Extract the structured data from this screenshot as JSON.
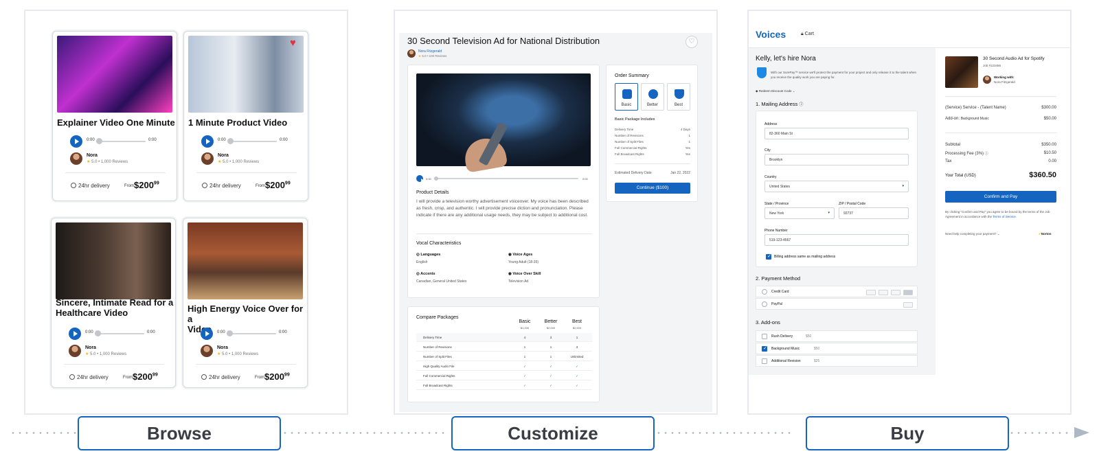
{
  "browse": {
    "cards": [
      {
        "title_lines": [
          "Explainer Video One Minute"
        ],
        "time_start": "0:00",
        "time_end": "0:00",
        "seller": "Nora",
        "rating": "5.0 • 1,000 Reviews",
        "delivery": "24hr delivery",
        "from": "From",
        "price": "$200",
        "price_cents": "99",
        "favorited": false
      },
      {
        "title_lines": [
          "1 Minute Product Video"
        ],
        "time_start": "0:00",
        "time_end": "0:00",
        "seller": "Nora",
        "rating": "5.0 • 1,000 Reviews",
        "delivery": "24hr delivery",
        "from": "From",
        "price": "$200",
        "price_cents": "99",
        "favorited": true
      },
      {
        "title_lines": [
          "Sincere, Intimate Read for a",
          "Healthcare Video"
        ],
        "time_start": "0:00",
        "time_end": "0:00",
        "seller": "Nora",
        "rating": "5.0 • 1,000 Reviews",
        "delivery": "24hr delivery",
        "from": "From",
        "price": "$200",
        "price_cents": "99",
        "favorited": false
      },
      {
        "title_lines": [
          "High Energy Voice Over for a",
          "Video"
        ],
        "time_start": "0:00",
        "time_end": "0:00",
        "seller": "Nora",
        "rating": "5.0 • 1,000 Reviews",
        "delivery": "24hr delivery",
        "from": "From",
        "price": "$200",
        "price_cents": "99",
        "favorited": false
      }
    ]
  },
  "customize": {
    "title": "30 Second Television Ad for National Distribution",
    "seller": "Nora Fitzgerald",
    "reviews": "5.0 • 100 Reviews",
    "audio_start": "0:00",
    "audio_end": "0:00",
    "product_details_label": "Product Details",
    "product_details_text": "I will provide a television worthy advertisement voiceover. My voice has been described as fresh, crisp, and authentic. I will provide precise diction and pronunciation. Please indicate if there are any additional usage needs, they may be subject to additional cost.",
    "vocal_label": "Vocal Characteristics",
    "languages_label": "Languages",
    "languages_value": "English",
    "voice_ages_label": "Voice Ages",
    "voice_ages_value": "Young Adult (18-35)",
    "accents_label": "Accents",
    "accents_value": "Canadian, General United States",
    "skill_label": "Voice Over Skill",
    "skill_value": "Television Ad",
    "order_summary": "Order Summary",
    "packages": [
      "Basic",
      "Better",
      "Best"
    ],
    "includes_label": "Basic Package Includes",
    "includes": [
      {
        "k": "Delivery Time",
        "v": "4 Days"
      },
      {
        "k": "Number of Revisions",
        "v": "1"
      },
      {
        "k": "Number of Split Files",
        "v": "1"
      },
      {
        "k": "Full Commercial Rights",
        "v": "Yes"
      },
      {
        "k": "Full Broadcast Rights",
        "v": "Yes"
      }
    ],
    "est_label": "Estimated Delivery Date",
    "est_value": "Jan 22, 2022",
    "continue": "Continue ($100)",
    "compare_label": "Compare Packages",
    "compare_cols": [
      {
        "name": "Basic",
        "price": "$1,200"
      },
      {
        "name": "Better",
        "price": "$2,000"
      },
      {
        "name": "Best",
        "price": "$2,500"
      }
    ],
    "compare_rows": [
      {
        "k": "Delivery Time",
        "v": [
          "4",
          "3",
          "1"
        ]
      },
      {
        "k": "Number of Revisions",
        "v": [
          "1",
          "1",
          "3"
        ]
      },
      {
        "k": "Number of Split Files",
        "v": [
          "1",
          "1",
          "Unlimited"
        ]
      },
      {
        "k": "High Quality Audio File",
        "v": [
          "✓",
          "✓",
          "✓"
        ]
      },
      {
        "k": "Full Commercial Rights",
        "v": [
          "✓",
          "✓",
          "✓"
        ]
      },
      {
        "k": "Full Broadcast Rights",
        "v": [
          "✓",
          "✓",
          "✓"
        ]
      }
    ]
  },
  "buy": {
    "logo": "Voices",
    "cart": "Cart",
    "heading": "Kelly, let's hire Nora",
    "surepay": "With our SurePay™ service we'll protect the payment for your project and only release it to the talent when you receive the quality work you are paying for.",
    "redeem": "Redeem Discount Code",
    "mailing_label": "1. Mailing Address",
    "address_label": "Address",
    "address_value": "82-360 Main St",
    "city_label": "City",
    "city_value": "Brooklyn",
    "country_label": "Country",
    "country_value": "United States",
    "state_label": "State / Province",
    "state_value": "New York",
    "zip_label": "ZIP / Postal Code",
    "zip_value": "92737",
    "phone_label": "Phone Number",
    "phone_value": "519-123-4567",
    "billing_same": "Billing address same as mailing address",
    "payment_label": "2. Payment Method",
    "payment_options": [
      "Credit Card",
      "PayPal"
    ],
    "addons_label": "3. Add-ons",
    "addons": [
      {
        "name": "Rush Delivery",
        "price": "$50",
        "checked": false
      },
      {
        "name": "Background Music",
        "price": "$50",
        "checked": true
      },
      {
        "name": "Additional Revision",
        "price": "$25",
        "checked": false
      }
    ],
    "job_title": "30 Second Audio Ad for Spotify",
    "job_id": "Job #123456",
    "working_with_label": "Working with:",
    "working_with": "Nora Fitzgerald",
    "service_k": "(Service) Service - (Talent Name)",
    "service_v": "$300.00",
    "addon_k": "Add-on:",
    "addon_name": "Background Music",
    "addon_v": "$50.00",
    "subtotal_k": "Subtotal",
    "subtotal_v": "$350.00",
    "fee_k": "Processing Fee (3%)",
    "fee_v": "$10.50",
    "tax_k": "Tax",
    "tax_v": "0.00",
    "total_k": "Your Total (USD)",
    "total_v": "$360.50",
    "confirm": "Confirm and Pay",
    "terms": "By clicking \"Confirm and Pay\" you agree to be bound by the terms of the Job Agreement in accordance with the",
    "terms_link": "Terms of Service",
    "help": "Need help completing your payment?",
    "norton": "Norton"
  },
  "steps": [
    "Browse",
    "Customize",
    "Buy"
  ],
  "colors": {
    "accent": "#1565c0",
    "heart": "#e5323f",
    "star": "#f5b301"
  }
}
